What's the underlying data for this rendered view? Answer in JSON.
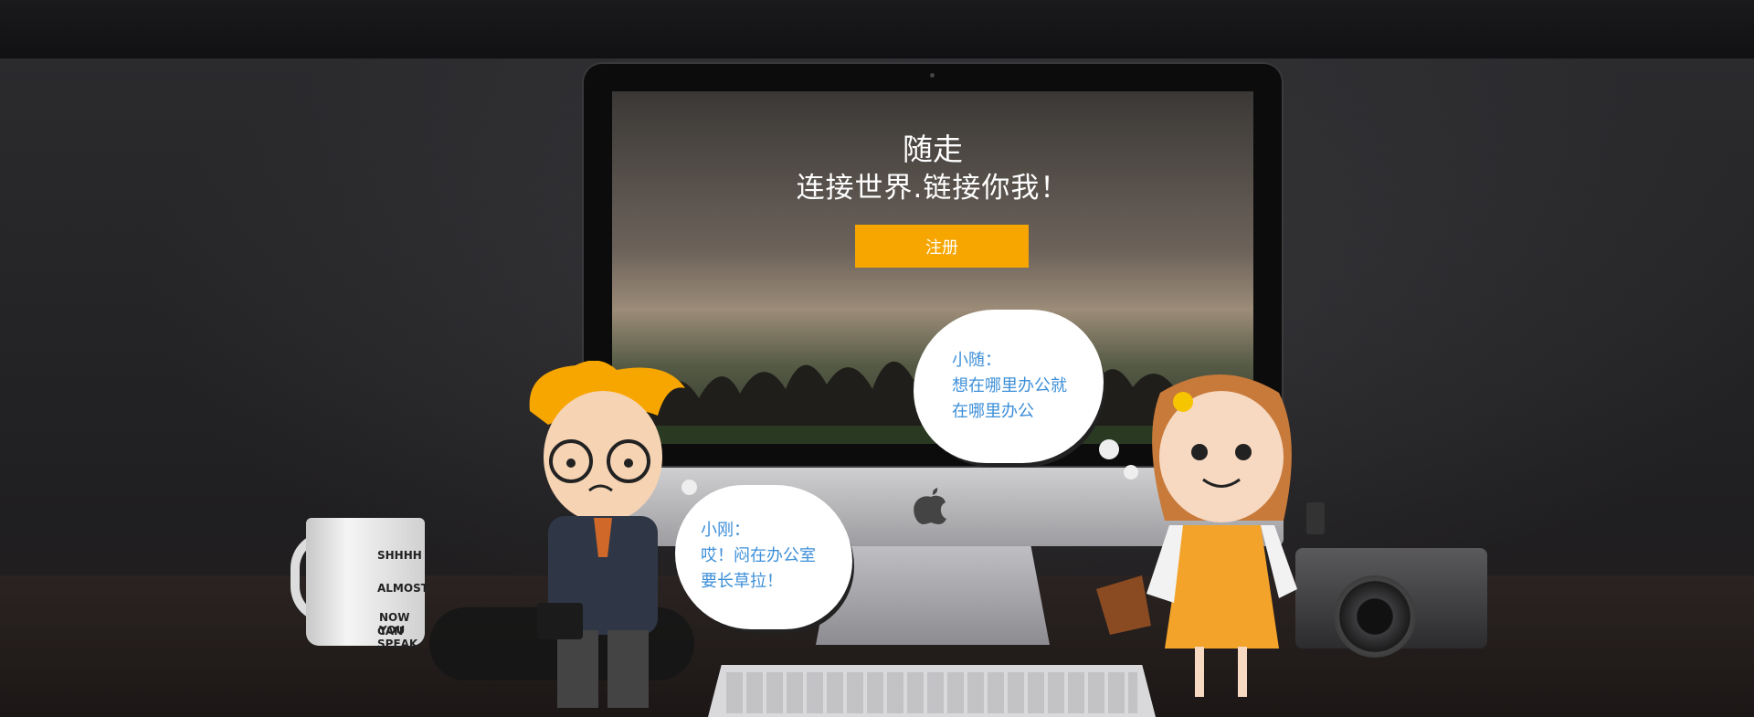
{
  "hero": {
    "title": "随走",
    "subtitle": "连接世界.链接你我！",
    "register_label": "注册"
  },
  "bubbles": {
    "xiaosui": {
      "name": "小随：",
      "line1": "想在哪里办公就",
      "line2": "在哪里办公"
    },
    "xiaogang": {
      "name": "小刚：",
      "line1": "哎！闷在办公室",
      "line2": "要长草拉！"
    }
  },
  "mug": {
    "line1": "SHHHH",
    "line2": "ALMOST",
    "line3": "NOW YOU",
    "line4": "CAN SPEAK"
  },
  "colors": {
    "accent": "#f7a600",
    "bubble_text": "#3d8fd8"
  }
}
